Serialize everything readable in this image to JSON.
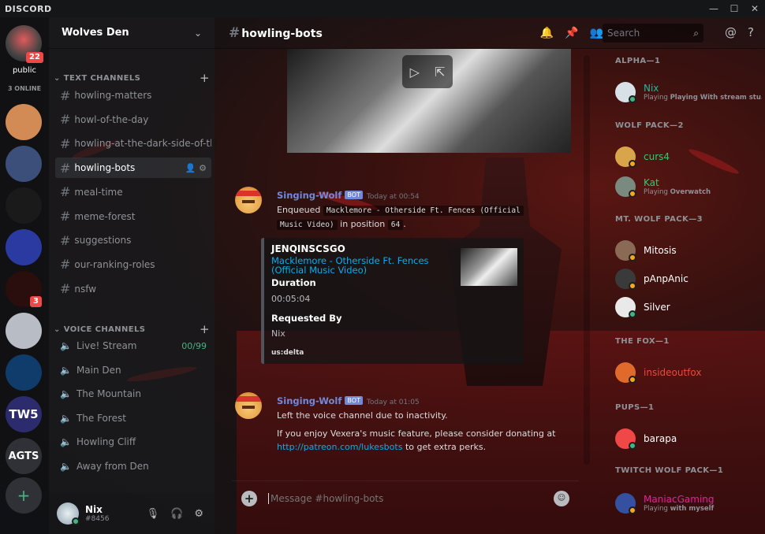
{
  "app": {
    "name": "DISCORD",
    "window_buttons": [
      "—",
      "☐",
      "✕"
    ]
  },
  "guilds": {
    "top": {
      "label": "public",
      "badge": "22",
      "online": "3 ONLINE"
    },
    "items": [
      {
        "name": "guild-husky",
        "color": "#d28b55",
        "badge": ""
      },
      {
        "name": "guild-town",
        "color": "#3b4f7a",
        "badge": ""
      },
      {
        "name": "guild-communism",
        "color": "#1a1a1a",
        "badge": ""
      },
      {
        "name": "guild-nebula",
        "color": "#2b3aa0",
        "badge": ""
      },
      {
        "name": "guild-red-eye",
        "color": "#2a0d0d",
        "badge": "3"
      },
      {
        "name": "guild-knight",
        "color": "#b8bcc4",
        "badge": ""
      },
      {
        "name": "guild-blue-ring",
        "color": "#0f3c6b",
        "badge": ""
      },
      {
        "name": "guild-tw5",
        "color": "#2b2b6e",
        "badge": "",
        "text": "TW5"
      },
      {
        "name": "guild-agts",
        "color": "#2f3136",
        "badge": "",
        "text": "AGTS"
      }
    ],
    "add": "+"
  },
  "server": {
    "name": "Wolves Den",
    "text_category": "TEXT CHANNELS",
    "text_channels": [
      "howling-matters",
      "howl-of-the-day",
      "howling-at-the-dark-side-of-th..",
      "howling-bots",
      "meal-time",
      "meme-forest",
      "suggestions",
      "our-ranking-roles",
      "nsfw"
    ],
    "active_channel": "howling-bots",
    "voice_category": "VOICE CHANNELS",
    "voice_channels": [
      {
        "name": "Live! Stream",
        "count": "00/99"
      },
      {
        "name": "Main Den"
      },
      {
        "name": "The Mountain"
      },
      {
        "name": "The Forest"
      },
      {
        "name": "Howling Cliff"
      },
      {
        "name": "Away from Den"
      }
    ]
  },
  "user": {
    "name": "Nix",
    "tag": "#8456"
  },
  "chat": {
    "title": "howling-bots",
    "search_placeholder": "Search",
    "input_placeholder": "Message #howling-bots"
  },
  "messages": [
    {
      "author": "Singing-Wolf",
      "bot": "BOT",
      "time": "Today at 00:54",
      "pre": "Enqueued",
      "code1": "Macklemore - Otherside Ft. Fences (Official",
      "code1b": "Music Video)",
      "mid": "in position",
      "code2": "64",
      "end": ".",
      "embed": {
        "title": "JENQINSCSGO",
        "link": "Macklemore - Otherside Ft. Fences (Official Music Video)",
        "f1_name": "Duration",
        "f1_val": "00:05:04",
        "f2_name": "Requested By",
        "f2_val": "Nix",
        "footer": "us:delta"
      }
    },
    {
      "author": "Singing-Wolf",
      "bot": "BOT",
      "time": "Today at 01:05",
      "line1": "Left the voice channel due to inactivity.",
      "line2": "If you enjoy Vexera's music feature, please consider donating at",
      "link": "http://patreon.com/lukesbots",
      "line3": "to get extra perks."
    }
  ],
  "members": [
    {
      "cat": "ALPHA—1",
      "users": [
        {
          "name": "Nix",
          "color": "#1abc9c",
          "sub": "Playing",
          "subb": "Playing With stream stu..",
          "status": "on",
          "av": "#d8e1e8"
        }
      ]
    },
    {
      "cat": "WOLF PACK—2",
      "users": [
        {
          "name": "curs4",
          "color": "#2ecc71",
          "status": "idle",
          "av": "#d9a54a"
        },
        {
          "name": "Kat",
          "color": "#2ecc71",
          "sub": "Playing",
          "subb": "Overwatch",
          "status": "idle",
          "av": "#7a8a80"
        }
      ]
    },
    {
      "cat": "MT. WOLF PACK—3",
      "users": [
        {
          "name": "Mitosis",
          "color": "#ffffff",
          "status": "idle",
          "av": "#8a6a55"
        },
        {
          "name": "pAnpAnic",
          "color": "#ffffff",
          "status": "idle",
          "av": "#3a3a3a"
        },
        {
          "name": "Silver",
          "color": "#ffffff",
          "status": "on",
          "av": "#e9e9e9"
        }
      ]
    },
    {
      "cat": "THE FOX—1",
      "users": [
        {
          "name": "insideoutfox",
          "color": "#e74c3c",
          "status": "idle",
          "av": "#e06a2b"
        }
      ]
    },
    {
      "cat": "PUPS—1",
      "users": [
        {
          "name": "barapa",
          "color": "#ffffff",
          "status": "on",
          "av": "#f04747"
        }
      ]
    },
    {
      "cat": "TWITCH WOLF PACK—1",
      "users": [
        {
          "name": "ManiacGaming",
          "color": "#e91e9c",
          "sub": "Playing",
          "subb": "with myself",
          "status": "idle",
          "av": "#3550a0"
        }
      ]
    }
  ]
}
